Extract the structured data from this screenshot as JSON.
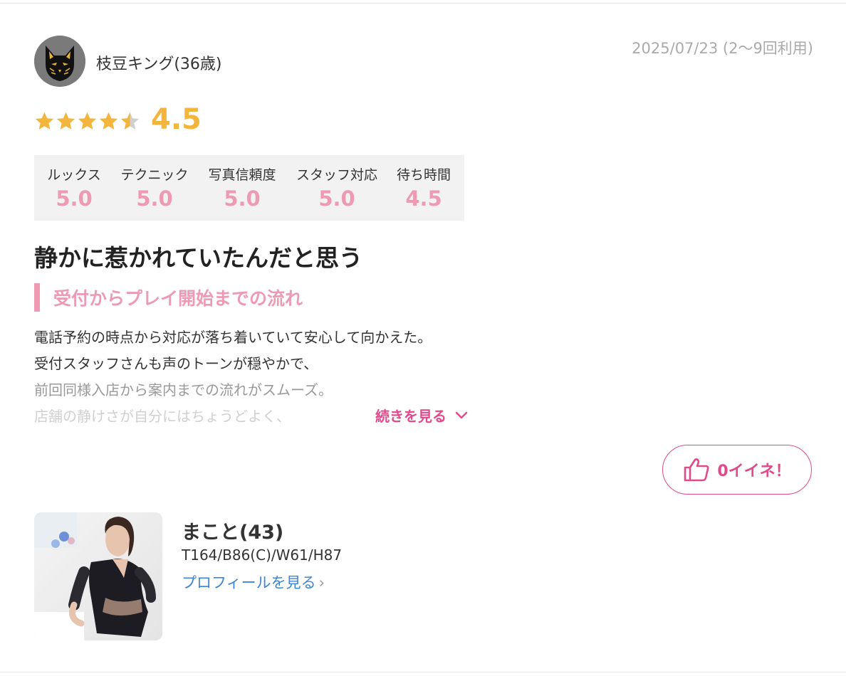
{
  "review": {
    "user_name": "枝豆キング(36歳)",
    "date": "2025/07/23 (2〜9回利用)",
    "rating": "4.5",
    "rating_value": 4.5,
    "rating_max": 5,
    "subratings": [
      {
        "label": "ルックス",
        "value": "5.0"
      },
      {
        "label": "テクニック",
        "value": "5.0"
      },
      {
        "label": "写真信頼度",
        "value": "5.0"
      },
      {
        "label": "スタッフ対応",
        "value": "5.0"
      },
      {
        "label": "待ち時間",
        "value": "4.5"
      }
    ],
    "title": "静かに惹かれていたんだと思う",
    "section_heading": "受付からプレイ開始までの流れ",
    "body_lines": [
      "電話予約の時点から対応が落ち着いていて安心して向かえた。",
      "受付スタッフさんも声のトーンが穏やかで、",
      "前回同様入店から案内までの流れがスムーズ。",
      "店舗の静けさが自分にはちょうどよく、"
    ],
    "more_label": "続きを見る",
    "like_label": "0イイネ！"
  },
  "profile": {
    "name": "まこと(43)",
    "stats": "T164/B86(C)/W61/H87",
    "link_label": "プロフィールを見る",
    "link_chevron": "›"
  },
  "colors": {
    "accent_pink": "#e14a8a",
    "soft_pink": "#ee9ab5",
    "star_gold": "#f3b53b",
    "link_blue": "#3c86d6"
  },
  "icons": {
    "avatar": "fox-mask-icon",
    "star": "star-icon",
    "more": "chevron-down-icon",
    "like": "thumbs-up-icon"
  }
}
